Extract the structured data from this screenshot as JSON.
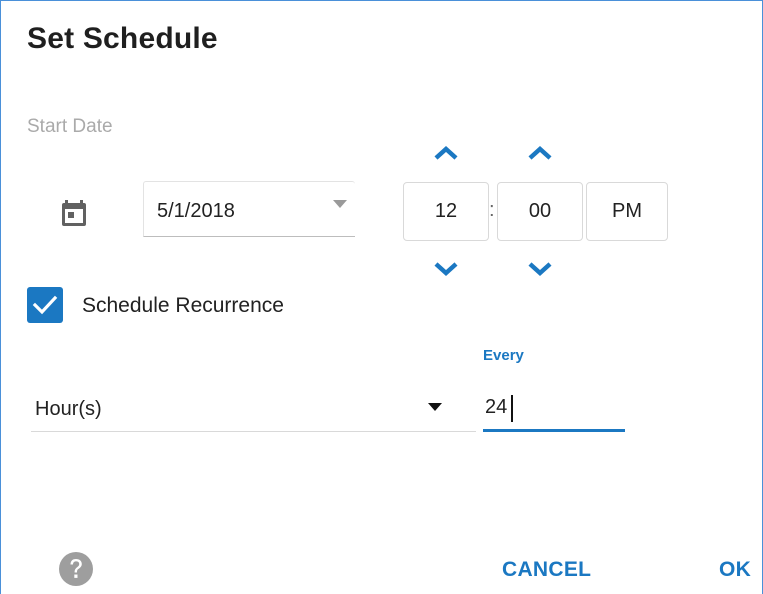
{
  "dialog": {
    "title": "Set Schedule",
    "start_date_label": "Start Date",
    "date_value": "5/1/2018",
    "time": {
      "hour": "12",
      "separator": ":",
      "minute": "00",
      "meridiem": "PM"
    },
    "recurrence": {
      "label": "Schedule Recurrence",
      "checked": true
    },
    "interval": {
      "unit_value": "Hour(s)",
      "every_label": "Every",
      "every_value": "24"
    },
    "buttons": {
      "cancel": "CANCEL",
      "ok": "OK"
    }
  },
  "colors": {
    "accent": "#1b78c2",
    "border": "#4a90d9",
    "muted_label": "#aaaaaa",
    "icon_gray": "#616161"
  },
  "icons": {
    "calendar": "calendar-icon",
    "up": "chevron-up-icon",
    "down": "chevron-down-icon",
    "check": "check-icon",
    "help": "help-circle-icon"
  }
}
